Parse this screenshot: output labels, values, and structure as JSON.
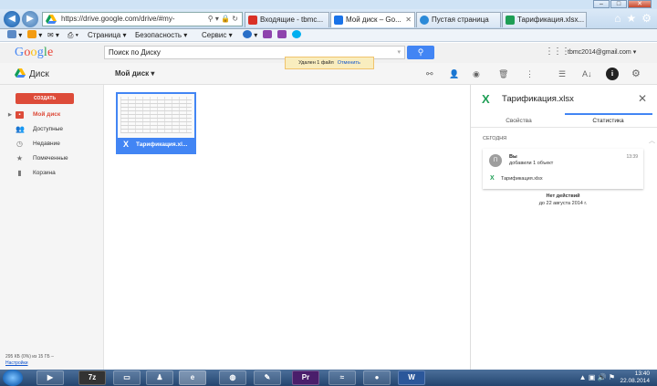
{
  "ie": {
    "address": "https://drive.google.com/drive/#my-",
    "tabs": [
      {
        "label": "Входящие - tbmc...",
        "icon": "gmail-icon",
        "color": "#d93025"
      },
      {
        "label": "Мой диск – Go...",
        "icon": "drive-icon",
        "color": "#1a73e8",
        "active": true
      },
      {
        "label": "Пустая страница",
        "icon": "ie-icon",
        "color": "#2b8ad8"
      },
      {
        "label": "Тарификация.xlsx...",
        "icon": "sheets-icon",
        "color": "#1e9e55"
      }
    ],
    "menu": {
      "page": "Страница ▾",
      "security": "Безопасность ▾",
      "service": "Сервис ▾"
    }
  },
  "google": {
    "logo": "Google",
    "search_placeholder": "Поиск по Диску",
    "account": "tbmc2014@gmail.com ▾"
  },
  "toolbar": {
    "disk_label": "Диск",
    "location": "Мой диск ▾"
  },
  "toast": {
    "message": "Удален 1 файл",
    "undo": "Отменить"
  },
  "sidebar": {
    "create": "СОЗДАТЬ",
    "items": [
      {
        "label": "Мой диск",
        "icon": "folder-icon",
        "active": true
      },
      {
        "label": "Доступные",
        "icon": "people-icon"
      },
      {
        "label": "Недавние",
        "icon": "clock-icon"
      },
      {
        "label": "Помеченные",
        "icon": "star-icon"
      },
      {
        "label": "Корзина",
        "icon": "trash-icon"
      }
    ],
    "storage": "295 КБ (0%) из 15 ГБ –",
    "settings_link": "Настройки"
  },
  "file": {
    "name": "Тарификация.xl..."
  },
  "details": {
    "title": "Тарификация.xlsx",
    "tab_properties": "Свойства",
    "tab_stats": "Статистика",
    "today": "СЕГОДНЯ",
    "activity": {
      "avatar": "П",
      "who": "Вы",
      "what": "добавили 1 объект",
      "time": "13:39",
      "file": "Тарификация.xlsx"
    },
    "no_actions": "Нет действий",
    "no_actions_until": "до 22 августа 2014 г."
  },
  "taskbar": {
    "time": "13:40",
    "date": "22.08.2014"
  }
}
